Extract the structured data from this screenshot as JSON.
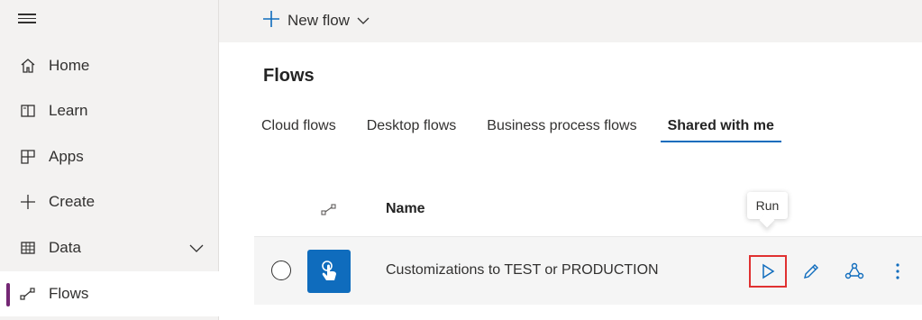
{
  "sidebar": {
    "items": [
      {
        "label": "Home",
        "icon": "home-icon"
      },
      {
        "label": "Learn",
        "icon": "book-icon"
      },
      {
        "label": "Apps",
        "icon": "apps-icon"
      },
      {
        "label": "Create",
        "icon": "plus-icon"
      },
      {
        "label": "Data",
        "icon": "table-icon"
      },
      {
        "label": "Flows",
        "icon": "flow-icon"
      }
    ],
    "active": "Flows"
  },
  "toolbar": {
    "new_flow_label": "New flow"
  },
  "page": {
    "title": "Flows"
  },
  "tabs": [
    {
      "label": "Cloud flows",
      "selected": false
    },
    {
      "label": "Desktop flows",
      "selected": false
    },
    {
      "label": "Business process flows",
      "selected": false
    },
    {
      "label": "Shared with me",
      "selected": true
    }
  ],
  "table": {
    "columns": {
      "name": "Name"
    },
    "rows": [
      {
        "name": "Customizations to TEST or PRODUCTION",
        "icon": "touch-icon"
      }
    ]
  },
  "tooltip": {
    "text": "Run"
  },
  "colors": {
    "accent": "#0f6cbd",
    "active_indicator": "#742774",
    "highlight": "#e03131"
  }
}
